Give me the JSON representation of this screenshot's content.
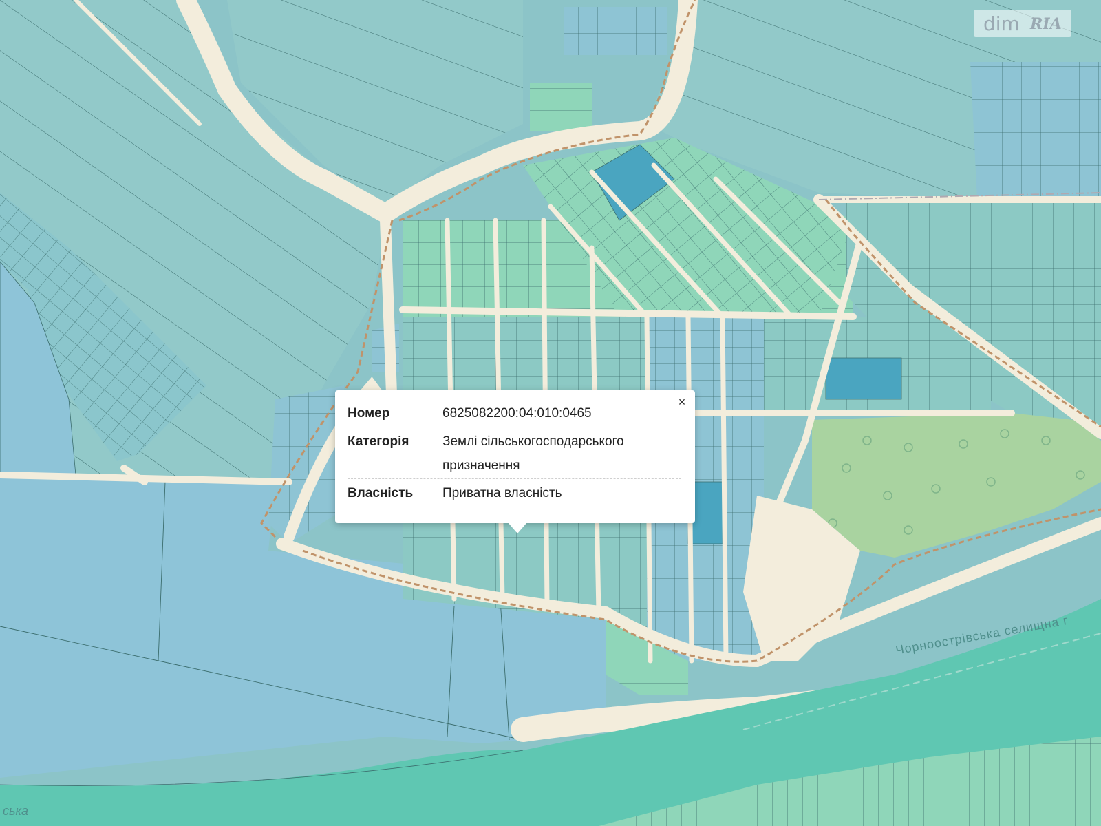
{
  "map": {
    "colors": {
      "base": "#8cc4c8",
      "parcel_teal": "#92c9c9",
      "parcel_blue": "#8ec4d8",
      "parcel_green": "#8fd6b9",
      "parcel_dark": "#3f9fbf",
      "road": "#f3eddc",
      "forest": "#a9d3a0",
      "river": "#5fc7b2",
      "line": "#3b6d6d",
      "boundary": "#c0936a"
    },
    "river_label": "Чорноострівська селищна г",
    "corner_label": "ська"
  },
  "popup": {
    "close_label": "×",
    "rows": [
      {
        "label": "Номер",
        "value": "6825082200:04:010:0465"
      },
      {
        "label": "Категорія",
        "value": "Землі сільськогосподарського призначення"
      },
      {
        "label": "Власність",
        "value": "Приватна власність"
      }
    ]
  },
  "watermark": {
    "left": "dim",
    "right": "RIA"
  }
}
